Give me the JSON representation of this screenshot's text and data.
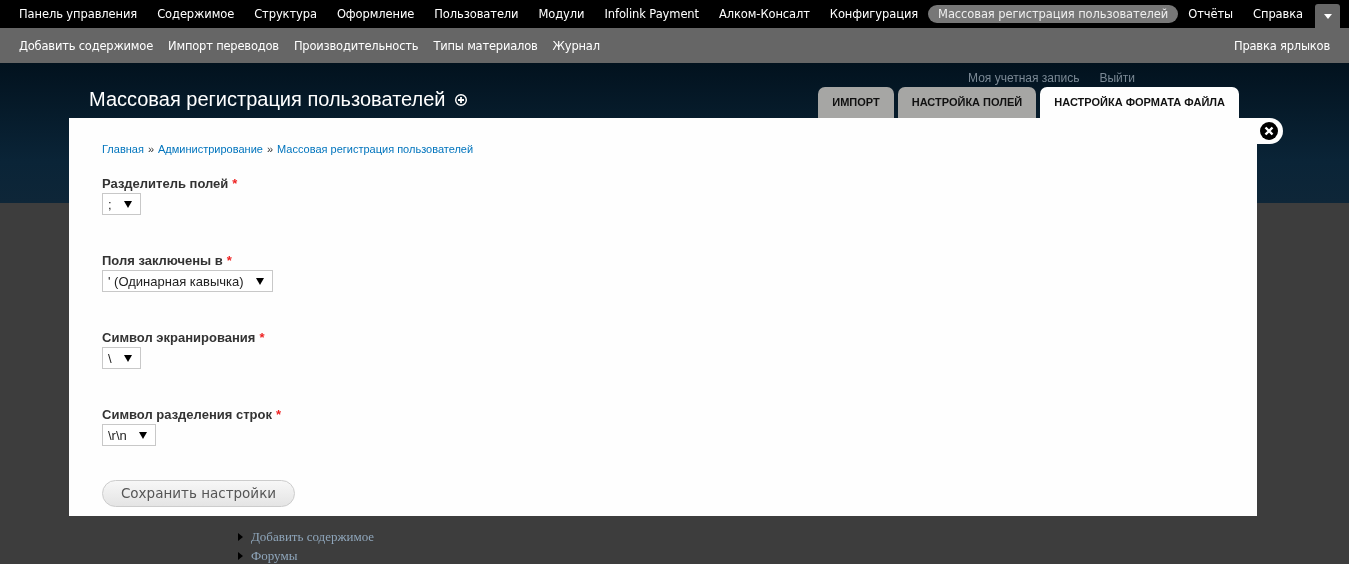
{
  "toolbar": {
    "items": [
      {
        "label": "Панель управления",
        "selected": false
      },
      {
        "label": "Содержимое",
        "selected": false
      },
      {
        "label": "Структура",
        "selected": false
      },
      {
        "label": "Оформление",
        "selected": false
      },
      {
        "label": "Пользователи",
        "selected": false
      },
      {
        "label": "Модули",
        "selected": false
      },
      {
        "label": "Infolink Payment",
        "selected": false
      },
      {
        "label": "Алком-Консалт",
        "selected": false
      },
      {
        "label": "Конфигурация",
        "selected": false
      },
      {
        "label": "Массовая регистрация пользователей",
        "selected": true
      },
      {
        "label": "Отчёты",
        "selected": false
      },
      {
        "label": "Справка",
        "selected": false
      }
    ]
  },
  "shortcuts": {
    "items": [
      "Добавить содержимое",
      "Импорт переводов",
      "Производительность",
      "Типы материалов",
      "Журнал"
    ],
    "edit_link": "Правка ярлыков"
  },
  "background_page": {
    "user_links": [
      "Моя учетная запись",
      "Выйти"
    ],
    "menu": [
      "Добавить содержимое",
      "Форумы"
    ]
  },
  "overlay": {
    "title": "Массовая регистрация пользователей",
    "tabs": [
      {
        "label": "ИМПОРТ",
        "selected": false
      },
      {
        "label": "НАСТРОЙКА ПОЛЕЙ",
        "selected": false
      },
      {
        "label": "НАСТРОЙКА ФОРМАТА ФАЙЛА",
        "selected": true
      }
    ],
    "breadcrumb": {
      "separator": "»",
      "items": [
        "Главная",
        "Администрирование",
        "Массовая регистрация пользователей"
      ]
    },
    "fields": [
      {
        "label": "Разделитель полей",
        "required_mark": "*",
        "value": ";"
      },
      {
        "label": "Поля заключены в",
        "required_mark": "*",
        "value": "' (Одинарная кавычка)"
      },
      {
        "label": "Символ экранирования",
        "required_mark": "*",
        "value": "\\"
      },
      {
        "label": "Символ разделения строк",
        "required_mark": "*",
        "value": "\\r\\n"
      }
    ],
    "submit": "Сохранить настройки"
  }
}
